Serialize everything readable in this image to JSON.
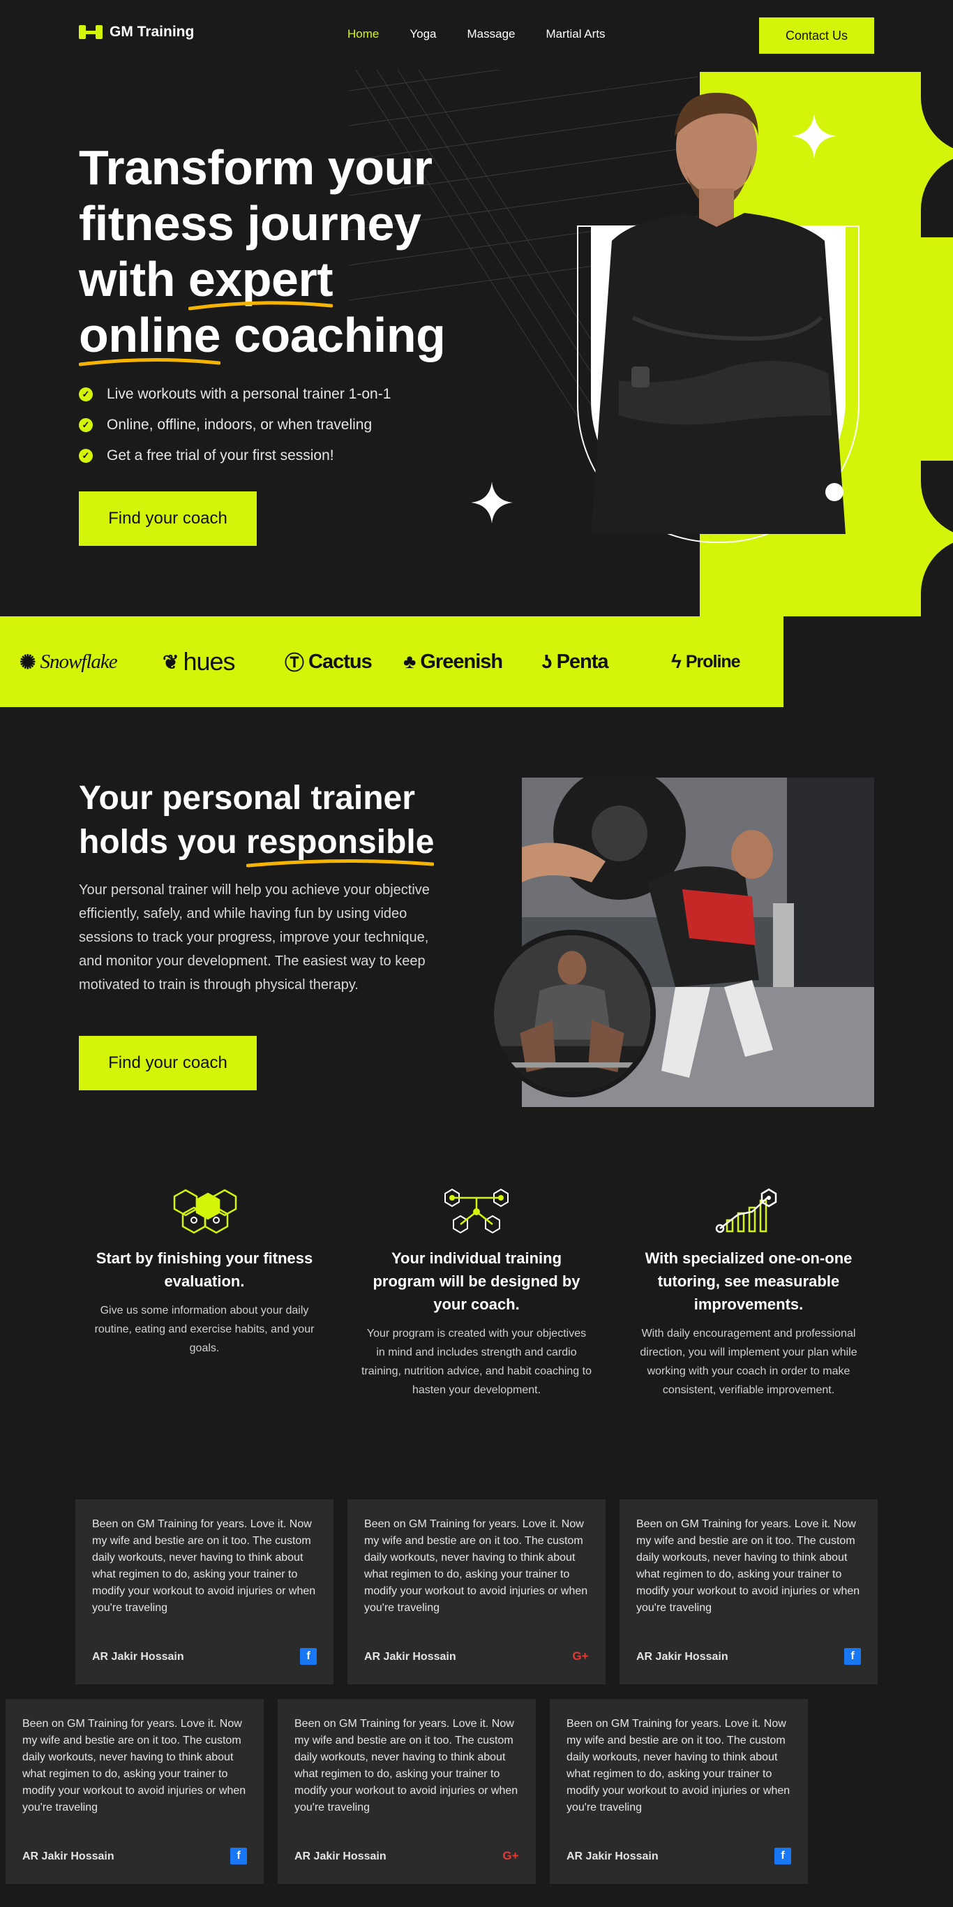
{
  "nav": {
    "brand": "GM Training",
    "links": [
      "Home",
      "Yoga",
      "Massage",
      "Martial Arts"
    ],
    "contact": "Contact Us"
  },
  "hero": {
    "title_lines": [
      "Transform your",
      "fitness journey",
      "with ",
      "expert",
      " coaching"
    ],
    "title_l4a": "online",
    "bullets": [
      "Live workouts with a personal trainer 1-on-1",
      "Online, offline, indoors, or when traveling",
      "Get a free trial of your first session!"
    ],
    "cta": "Find your coach"
  },
  "brands": [
    "Snowflake",
    "hues",
    "Cactus",
    "Greenish",
    "Penta",
    "Proline"
  ],
  "section2": {
    "title_l1": "Your personal trainer",
    "title_l2a": "holds you ",
    "title_l2b": "responsible",
    "body": "Your personal trainer will help you achieve your objective efficiently, safely, and while having fun by using video sessions to track your progress, improve your technique, and monitor your development. The easiest way to keep motivated to train is through physical therapy.",
    "cta": "Find your coach"
  },
  "features": [
    {
      "icon": "hexagon-cluster-icon",
      "title": "Start by finishing your fitness evaluation.",
      "text": "Give us some information about your daily routine, eating and exercise habits, and your goals."
    },
    {
      "icon": "network-nodes-icon",
      "title": "Your individual training program will be designed by your coach.",
      "text": "Your program is created with your objectives in mind and includes strength and cardio training, nutrition advice, and habit coaching to hasten your development."
    },
    {
      "icon": "growth-chart-icon",
      "title": "With specialized one-on-one tutoring, see measurable improvements.",
      "text": "With daily encouragement and professional direction, you will implement your plan while working with your coach in order to make consistent, verifiable improvement."
    }
  ],
  "testimonials": [
    {
      "text": "Been on GM Training for years. Love it. Now my wife and bestie are on it too. The custom daily workouts, never having to think about what regimen to do, asking your trainer to modify your workout to avoid injuries or when you're traveling",
      "name": "AR Jakir Hossain",
      "social": "facebook"
    },
    {
      "text": "Been on GM Training for years. Love it. Now my wife and bestie are on it too. The custom daily workouts, never having to think about what regimen to do, asking your trainer to modify your workout to avoid injuries or when you're traveling",
      "name": "AR Jakir Hossain",
      "social": "google-plus"
    },
    {
      "text": "Been on GM Training for years. Love it. Now my wife and bestie are on it too. The custom daily workouts, never having to think about what regimen to do, asking your trainer to modify your workout to avoid injuries or when you're traveling",
      "name": "AR Jakir Hossain",
      "social": "facebook"
    },
    {
      "text": "Been on GM Training for years. Love it. Now my wife and bestie are on it too. The custom daily workouts, never having to think about what regimen to do, asking your trainer to modify your workout to avoid injuries or when you're traveling",
      "name": "AR Jakir Hossain",
      "social": "facebook"
    },
    {
      "text": "Been on GM Training for years. Love it. Now my wife and bestie are on it too. The custom daily workouts, never having to think about what regimen to do, asking your trainer to modify your workout to avoid injuries or when you're traveling",
      "name": "AR Jakir Hossain",
      "social": "google-plus"
    },
    {
      "text": "Been on GM Training for years. Love it. Now my wife and bestie are on it too. The custom daily workouts, never having to think about what regimen to do, asking your trainer to modify your workout to avoid injuries or when you're traveling",
      "name": "AR Jakir Hossain",
      "social": "facebook"
    }
  ],
  "colors": {
    "accent": "#d4f50a",
    "background": "#1a1a1a",
    "card": "#2b2b2b",
    "underline": "#f5b400"
  }
}
